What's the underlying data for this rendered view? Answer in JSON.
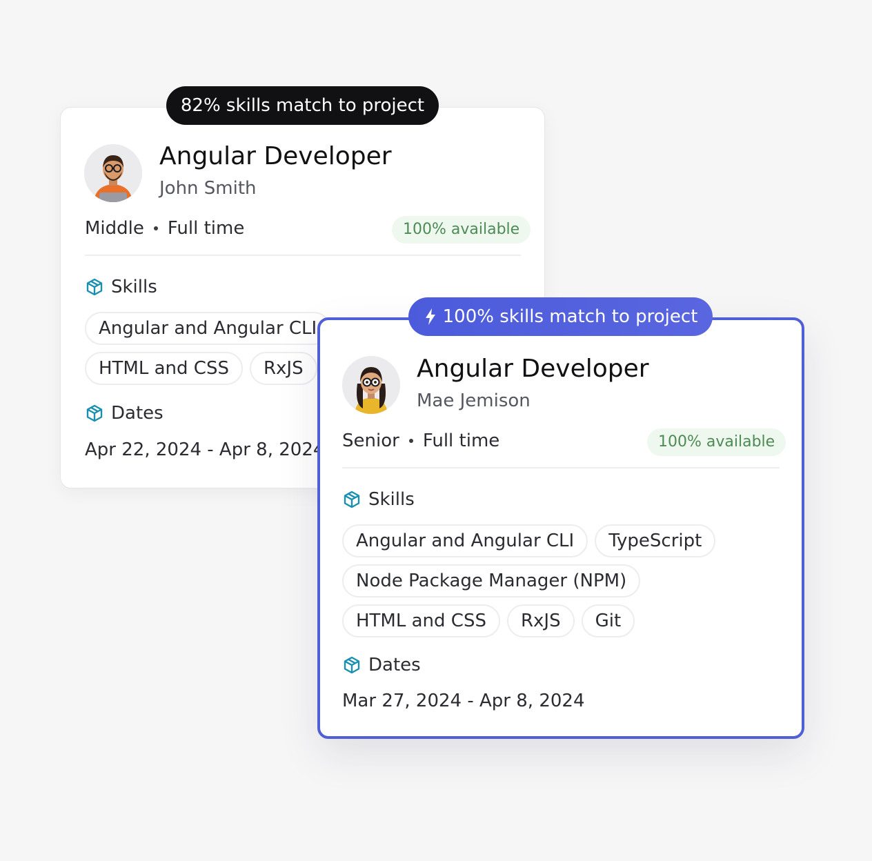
{
  "cards": [
    {
      "match_label": "82% skills match to project",
      "title": "Angular Developer",
      "name": "John Smith",
      "level": "Middle",
      "employment": "Full time",
      "availability": "100% available",
      "skills_heading": "Skills",
      "skills": [
        "Angular and Angular CLI",
        "HTML and CSS",
        "RxJS"
      ],
      "dates_heading": "Dates",
      "dates": "Apr 22, 2024 - Apr 8, 2024"
    },
    {
      "match_label": "100% skills match to project",
      "title": "Angular Developer",
      "name": "Mae Jemison",
      "level": "Senior",
      "employment": "Full time",
      "availability": "100% available",
      "skills_heading": "Skills",
      "skills": [
        "Angular and Angular CLI",
        "TypeScript",
        "Node Package Manager (NPM)",
        "HTML and CSS",
        "RxJS",
        "Git"
      ],
      "dates_heading": "Dates",
      "dates": "Mar 27, 2024 - Apr 8, 2024"
    }
  ],
  "icons": {
    "section": "cube-icon",
    "match_highlight": "lightning-bolt-icon"
  },
  "colors": {
    "accent": "#4f5fd6",
    "available_text": "#4e8b54",
    "available_bg": "#eef8ef",
    "section_icon": "#1a8fb0",
    "dark_pill": "#111114"
  }
}
